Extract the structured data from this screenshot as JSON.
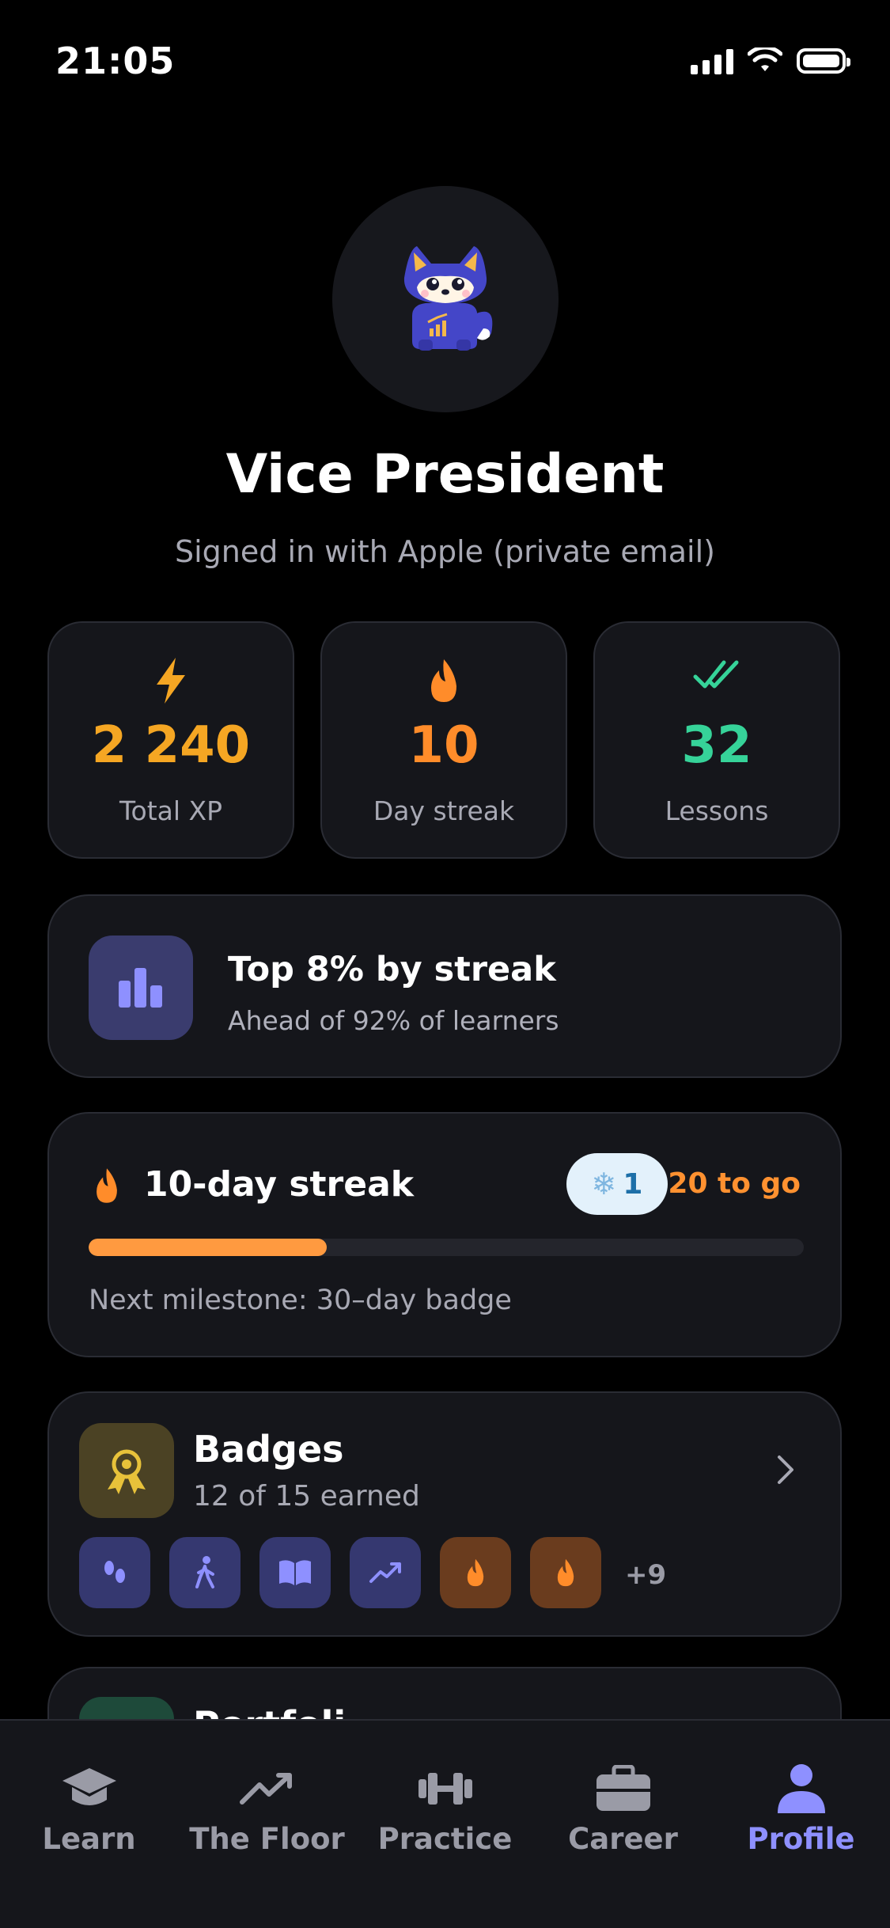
{
  "status_bar": {
    "time": "21:05"
  },
  "profile": {
    "name": "Vice President",
    "signin": "Signed in with Apple (private email)"
  },
  "stats": [
    {
      "icon": "lightning-icon",
      "value": "2 240",
      "label": "Total XP",
      "color": "#F5A623"
    },
    {
      "icon": "flame-icon",
      "value": "10",
      "label": "Day streak",
      "color": "#FF8C2A"
    },
    {
      "icon": "double-check-icon",
      "value": "32",
      "label": "Lessons",
      "color": "#36D399"
    }
  ],
  "rank": {
    "title": "Top 8% by streak",
    "subtitle": "Ahead of 92% of learners"
  },
  "streak": {
    "title": "10-day streak",
    "freeze_count": "1",
    "to_go": "20 to go",
    "progress": 0.333,
    "milestone": "Next milestone: 30–day badge"
  },
  "badges": {
    "title": "Badges",
    "subtitle": "12 of 15 earned",
    "chips": [
      "footprints-icon",
      "hiker-icon",
      "book-icon",
      "trend-up-icon",
      "flame-icon",
      "flame-icon"
    ],
    "more": "+9"
  },
  "next_card": {
    "title_partial": "Portfoli"
  },
  "tabs": [
    {
      "label": "Learn",
      "icon": "graduation-cap-icon",
      "active": false
    },
    {
      "label": "The Floor",
      "icon": "trend-up-icon",
      "active": false
    },
    {
      "label": "Practice",
      "icon": "dumbbell-icon",
      "active": false
    },
    {
      "label": "Career",
      "icon": "briefcase-icon",
      "active": false
    },
    {
      "label": "Profile",
      "icon": "person-icon",
      "active": true
    }
  ],
  "colors": {
    "accent": "#8E90FF",
    "streak_orange": "#FF9130",
    "xp_yellow": "#F5A623",
    "lessons_green": "#36D399",
    "card_bg": "#15161B"
  }
}
